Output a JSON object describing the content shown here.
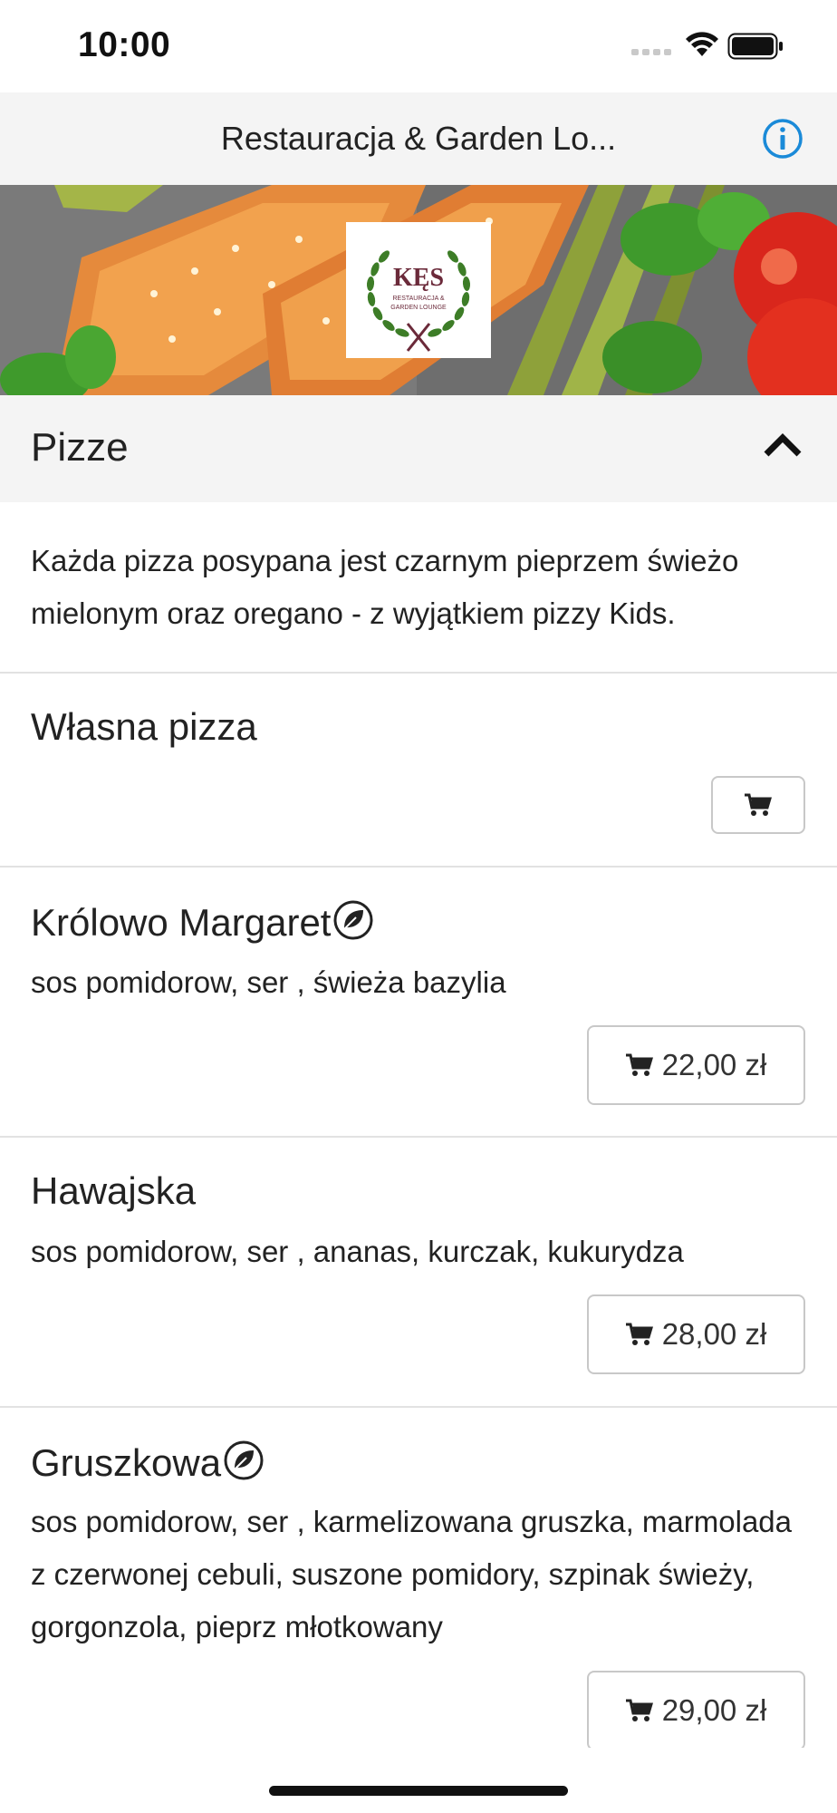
{
  "status_bar": {
    "time": "10:00"
  },
  "header": {
    "title": "Restauracja & Garden Lo..."
  },
  "logo": {
    "name": "KĘS",
    "subtitle": "RESTAURACJA & GARDEN LOUNGE"
  },
  "section": {
    "title": "Pizze",
    "intro": "Każda pizza posypana jest czarnym pieprzem świeżo mielonym oraz oregano - z wyjątkiem pizzy Kids."
  },
  "items": [
    {
      "name": "Własna pizza",
      "description": "",
      "price": "",
      "vegetarian": false
    },
    {
      "name": "Królowo Margaret",
      "description": " sos pomidorow, ser , świeża bazylia",
      "price": "22,00 zł",
      "vegetarian": true
    },
    {
      "name": "Hawajska",
      "description": " sos pomidorow, ser , ananas, kurczak, kukurydza",
      "price": "28,00 zł",
      "vegetarian": false
    },
    {
      "name": "Gruszkowa",
      "description": " sos pomidorow, ser , karmelizowana gruszka, marmolada z czerwonej cebuli, suszone pomidory, szpinak świeży, gorgonzola, pieprz młotkowany",
      "price": "29,00 zł",
      "vegetarian": true
    }
  ],
  "colors": {
    "accent": "#1a8ad8",
    "header_bg": "#f4f4f4",
    "divider": "#e2e2e2"
  }
}
